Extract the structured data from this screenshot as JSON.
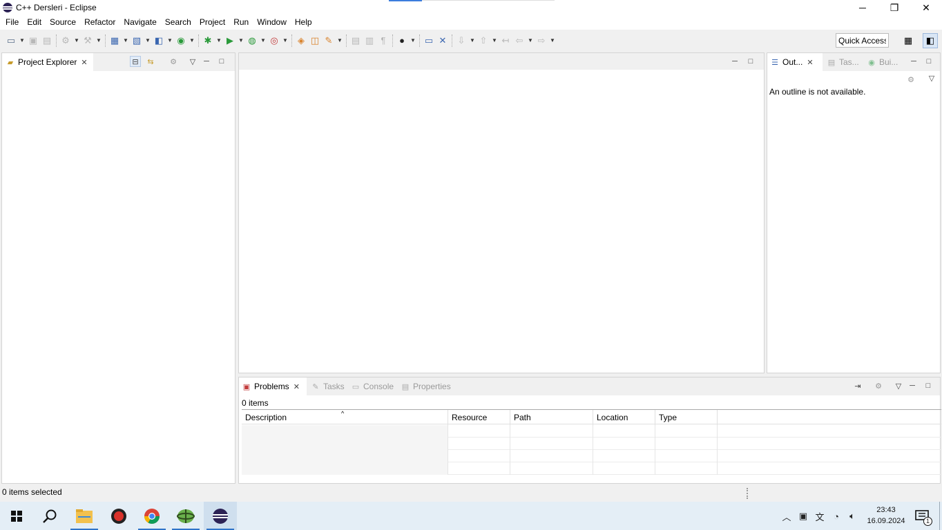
{
  "window": {
    "title": "C++ Dersleri - Eclipse",
    "controls": {
      "minimize": "─",
      "restore": "❐",
      "close": "✕"
    }
  },
  "menu": [
    "File",
    "Edit",
    "Source",
    "Refactor",
    "Navigate",
    "Search",
    "Project",
    "Run",
    "Window",
    "Help"
  ],
  "toolbar": {
    "quick_access": "Quick Access"
  },
  "project_explorer": {
    "tab_label": "Project Explorer"
  },
  "outline": {
    "tabs": [
      "Out...",
      "Tas...",
      "Bui..."
    ],
    "message": "An outline is not available."
  },
  "bottom_panel": {
    "tabs": [
      "Problems",
      "Tasks",
      "Console",
      "Properties"
    ],
    "item_count": "0 items",
    "columns": [
      "Description",
      "Resource",
      "Path",
      "Location",
      "Type"
    ]
  },
  "status_bar": {
    "text": "0 items selected"
  },
  "taskbar": {
    "time": "23:43",
    "date": "16.09.2024",
    "notification_count": "1"
  }
}
